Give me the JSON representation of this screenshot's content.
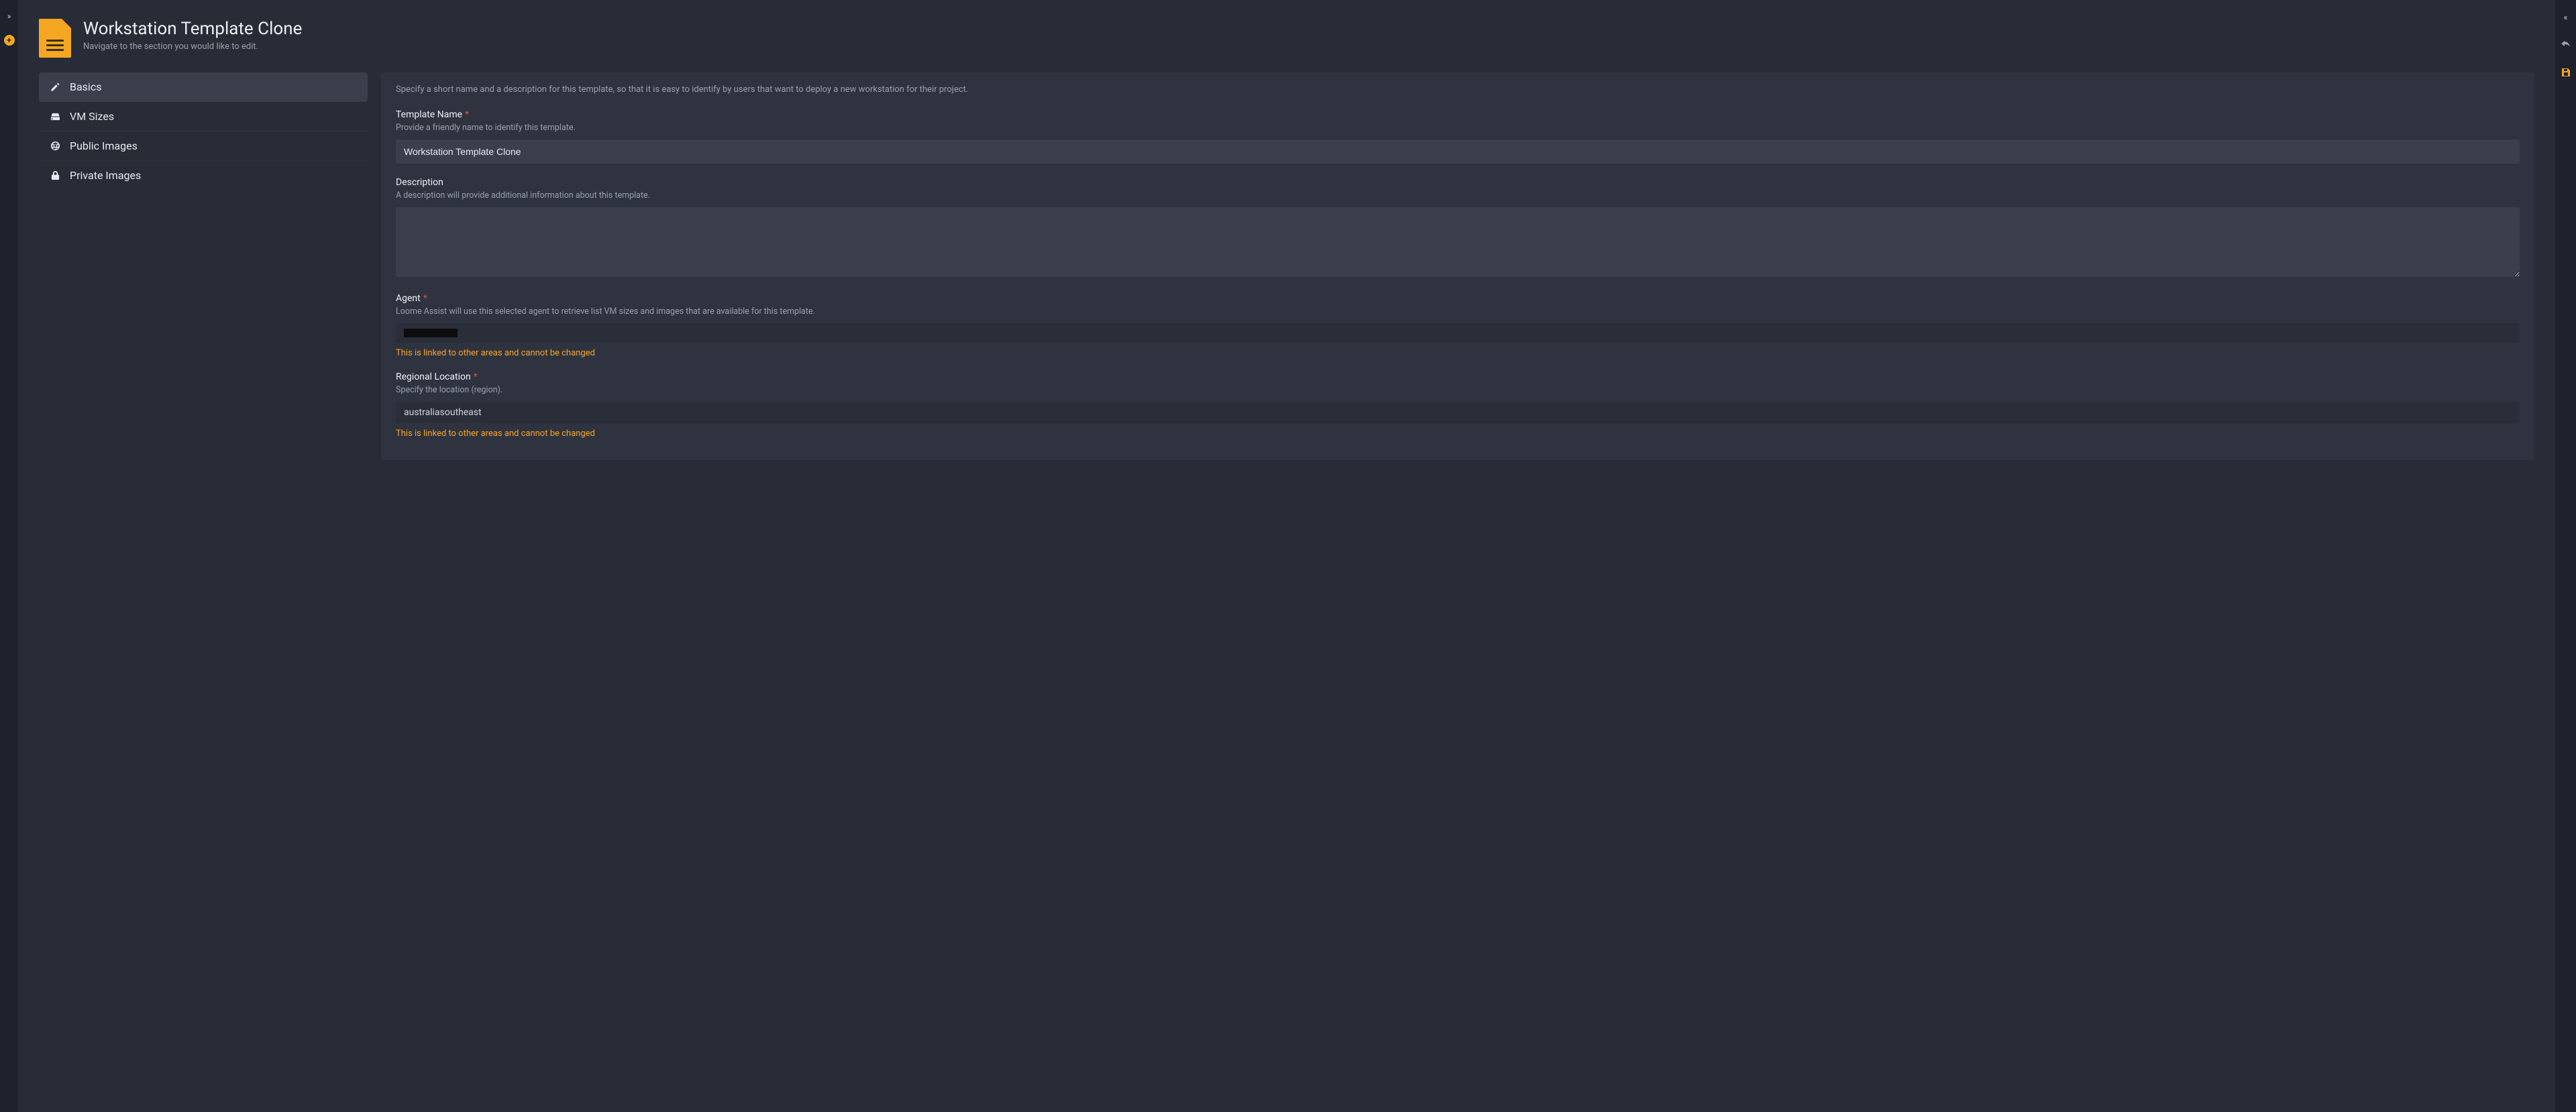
{
  "header": {
    "title": "Workstation Template Clone",
    "subtitle": "Navigate to the section you would like to edit."
  },
  "sidebar": {
    "items": [
      {
        "label": "Basics",
        "icon": "pencil-icon",
        "active": true
      },
      {
        "label": "VM Sizes",
        "icon": "hdd-icon",
        "active": false
      },
      {
        "label": "Public Images",
        "icon": "globe-icon",
        "active": false
      },
      {
        "label": "Private Images",
        "icon": "lock-icon",
        "active": false
      }
    ]
  },
  "panel": {
    "intro": "Specify a short name and a description for this template, so that it is easy to identify by users that want to deploy a new workstation for their project."
  },
  "fields": {
    "template_name": {
      "label": "Template Name",
      "required": true,
      "help": "Provide a friendly name to identify this template.",
      "value": "Workstation Template Clone"
    },
    "description": {
      "label": "Description",
      "required": false,
      "help": "A description will provide additional information about this template.",
      "value": ""
    },
    "agent": {
      "label": "Agent",
      "required": true,
      "help": "Loome Assist will use this selected agent to retrieve list VM sizes and images that are available for this template.",
      "value": "",
      "locked_note": "This is linked to other areas and cannot be changed"
    },
    "region": {
      "label": "Regional Location",
      "required": true,
      "help": "Specify the location (region).",
      "value": "australiasoutheast",
      "locked_note": "This is linked to other areas and cannot be changed"
    }
  },
  "required_marker": "*",
  "colors": {
    "accent": "#f5a623",
    "danger": "#e74c3c",
    "bg_app": "#1e222d",
    "bg_main": "#282c37",
    "bg_panel": "#2f3340",
    "bg_input": "#3a3f4b"
  }
}
